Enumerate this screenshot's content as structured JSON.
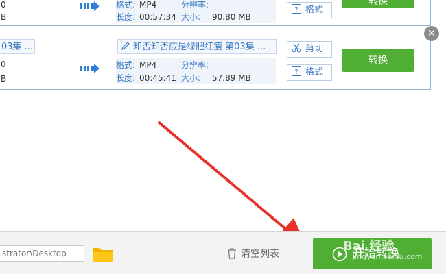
{
  "tasks": [
    {
      "src_title": "",
      "src_line1": "0",
      "src_line2": "B",
      "dst_title": "",
      "format_label": "格式:",
      "format_value": "MP4",
      "resolution_label": "分辨率:",
      "resolution_value": "",
      "duration_label": "长度:",
      "duration_value": "00:57:34",
      "size_label": "大小:",
      "size_value": "90.80 MB",
      "cut_label": "",
      "format_btn_label": "格式",
      "convert_label": "转换"
    },
    {
      "src_title": "03集 ...",
      "src_line1": "0",
      "src_line2": "B",
      "dst_title": "知否知否应是绿肥红瘦 第03集 ...",
      "format_label": "格式:",
      "format_value": "MP4",
      "resolution_label": "分辨率:",
      "resolution_value": "",
      "duration_label": "长度:",
      "duration_value": "00:45:41",
      "size_label": "大小:",
      "size_value": "57.89 MB",
      "cut_label": "剪切",
      "format_btn_label": "格式",
      "convert_label": "转换"
    }
  ],
  "bottom": {
    "output_path": "strator\\Desktop",
    "clear_label": "清空列表",
    "start_label": "开始转换"
  },
  "watermark": {
    "brand": "Bai 经验",
    "url": "jingyan.baidu.com"
  },
  "colors": {
    "accent_green": "#4fae33",
    "link_blue": "#3a78c3",
    "annotation_red": "#e8312b"
  },
  "icons": {
    "arrow": "convert-arrow-icon",
    "pen": "pen-icon",
    "scissors": "scissors-icon",
    "format": "format-icon",
    "close": "close-icon",
    "folder": "folder-icon",
    "trash": "trash-icon",
    "play": "play-circle-icon"
  }
}
